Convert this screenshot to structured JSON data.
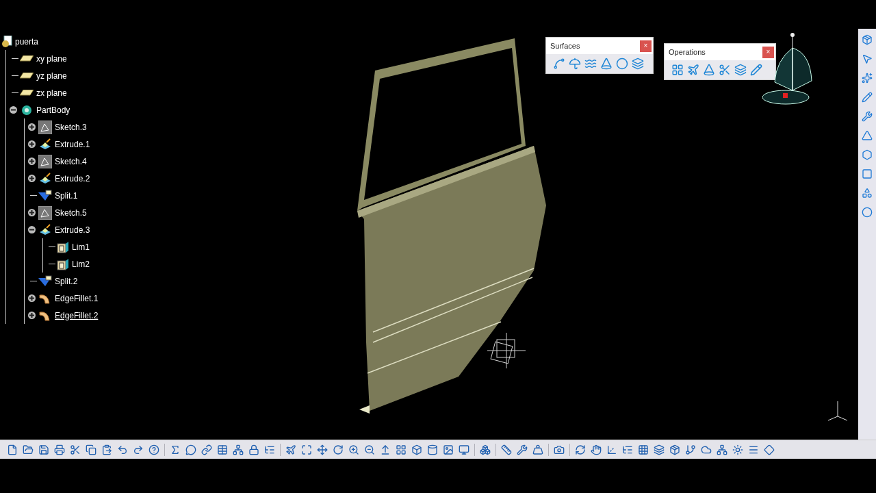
{
  "tree": {
    "label": "puerta",
    "kind": "part",
    "selected": false,
    "children": [
      {
        "label": "xy plane",
        "kind": "plane",
        "selected": false
      },
      {
        "label": "yz plane",
        "kind": "plane",
        "selected": false
      },
      {
        "label": "zx plane",
        "kind": "plane",
        "selected": false
      },
      {
        "label": "PartBody",
        "kind": "body",
        "selected": false,
        "expanded": true,
        "children": [
          {
            "label": "Sketch.3",
            "kind": "sketch",
            "selected": false,
            "expanded": false
          },
          {
            "label": "Extrude.1",
            "kind": "extrude",
            "selected": false,
            "expanded": false
          },
          {
            "label": "Sketch.4",
            "kind": "sketch",
            "selected": false,
            "expanded": false
          },
          {
            "label": "Extrude.2",
            "kind": "extrude",
            "selected": false,
            "expanded": false
          },
          {
            "label": "Split.1",
            "kind": "split",
            "selected": false
          },
          {
            "label": "Sketch.5",
            "kind": "sketch",
            "selected": false,
            "expanded": false
          },
          {
            "label": "Extrude.3",
            "kind": "extrude",
            "selected": false,
            "expanded": true,
            "children": [
              {
                "label": "Lim1",
                "kind": "limit",
                "selected": false
              },
              {
                "label": "Lim2",
                "kind": "limit",
                "selected": false
              }
            ]
          },
          {
            "label": "Split.2",
            "kind": "split",
            "selected": false
          },
          {
            "label": "EdgeFillet.1",
            "kind": "fillet",
            "selected": false,
            "expanded": false
          },
          {
            "label": "EdgeFillet.2",
            "kind": "fillet",
            "selected": true,
            "expanded": false
          }
        ]
      }
    ]
  },
  "toolbars": [
    {
      "title": "Surfaces",
      "close": "×"
    },
    {
      "title": "Operations",
      "close": "×"
    }
  ]
}
